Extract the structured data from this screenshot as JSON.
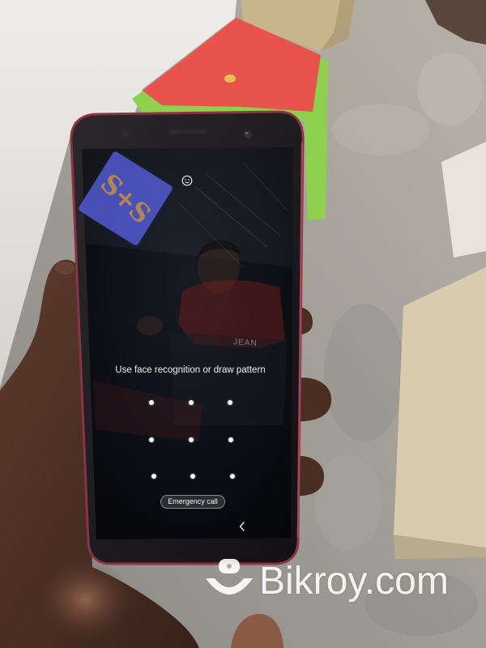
{
  "lock_screen": {
    "face_unlock_icon": "face-recognition-icon",
    "prompt": "Use face recognition or draw pattern",
    "emergency_call_label": "Emergency call",
    "back_icon": "back-chevron-icon"
  },
  "sticker": {
    "text": "S+S"
  },
  "reflection": {
    "shirt_text": "JEAN"
  },
  "watermark": {
    "brand_text": "Bikroy.com",
    "logo_icon": "bikroy-logo-icon"
  },
  "colors": {
    "phone_rim": "#8a3346",
    "sticker_blue": "#5058cc",
    "sticker_ink": "#c8945c",
    "screen_text": "#f2f2f2"
  }
}
